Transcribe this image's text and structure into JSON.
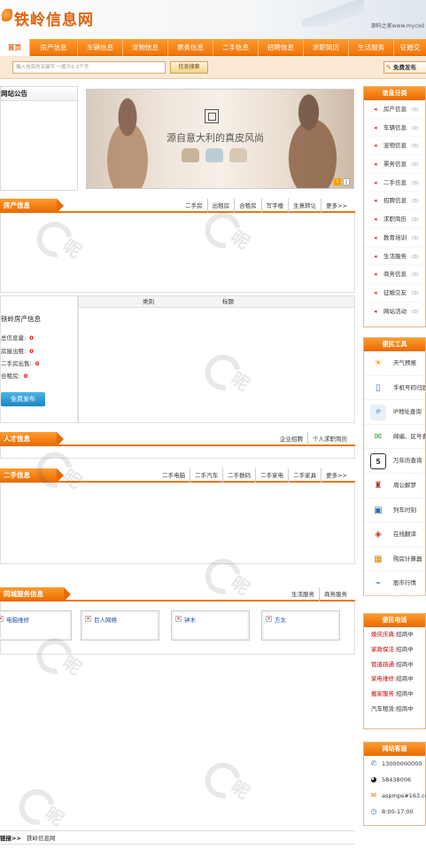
{
  "header": {
    "site_name": "铁岭信息网",
    "right_text": "源码之家www.mycod"
  },
  "nav": {
    "items": [
      "首页",
      "房产信息",
      "车辆信息",
      "宠物信息",
      "票务信息",
      "二手信息",
      "招聘信息",
      "求职简历",
      "生活服务",
      "征婚交"
    ]
  },
  "search": {
    "placeholder": "输入信息的关键字 一般为2-3个字",
    "button": "信息搜索",
    "publish": "免费发布"
  },
  "announce": {
    "title": "网站公告"
  },
  "banner": {
    "tagline": "源自意大利的真皮风尚",
    "pager": [
      "1",
      "2"
    ]
  },
  "sections": {
    "house": {
      "title": "房产信息",
      "links": [
        "二手房",
        "出租房",
        "合租房",
        "写字楼",
        "生意转让",
        "更多>>"
      ]
    },
    "talent": {
      "title": "人才信息",
      "links": [
        "企业招聘",
        "个人求职简历"
      ]
    },
    "second": {
      "title": "二手信息",
      "links": [
        "二手电脑",
        "二手汽车",
        "二手数码",
        "二手家电",
        "二手家具",
        "更多>>"
      ]
    },
    "city": {
      "title": "同城服务信息",
      "links": [
        "生活服务",
        "商务服务"
      ]
    }
  },
  "house_stats": {
    "title": "铁岭房产信息",
    "rows": [
      {
        "label": "总信息量:",
        "value": "0"
      },
      {
        "label": "房屋出租:",
        "value": "0"
      },
      {
        "label": "二手房出售:",
        "value": "0"
      },
      {
        "label": "合租房:",
        "value": "0"
      }
    ],
    "button": "免费发布"
  },
  "house_table": {
    "headers": [
      "类别",
      "标题"
    ]
  },
  "city_services": [
    "电脑维修",
    "巨人网络",
    "钟木",
    "方太"
  ],
  "sidebar": {
    "categories": {
      "title": "信息分类",
      "items": [
        {
          "label": "房产信息",
          "count": "(0)"
        },
        {
          "label": "车辆信息",
          "count": "(0)"
        },
        {
          "label": "宠物信息",
          "count": "(0)"
        },
        {
          "label": "票务信息",
          "count": "(0)"
        },
        {
          "label": "二手信息",
          "count": "(0)"
        },
        {
          "label": "招聘信息",
          "count": "(0)"
        },
        {
          "label": "求职简历",
          "count": "(0)"
        },
        {
          "label": "教育培训",
          "count": "(0)"
        },
        {
          "label": "生活服务",
          "count": "(0)"
        },
        {
          "label": "商务信息",
          "count": "(0)"
        },
        {
          "label": "征婚交友",
          "count": "(0)"
        },
        {
          "label": "网站活动",
          "count": "(0)"
        }
      ]
    },
    "tools": {
      "title": "便民工具",
      "items": [
        {
          "label": "天气预报",
          "icon": "sun-icon"
        },
        {
          "label": "手机号码归属",
          "icon": "phone-icon"
        },
        {
          "label": "IP地址查询",
          "icon": "ip-icon"
        },
        {
          "label": "邮编、区号查",
          "icon": "mail-icon"
        },
        {
          "label": "万年历查询",
          "icon": "calendar-icon"
        },
        {
          "label": "周公解梦",
          "icon": "person-icon"
        },
        {
          "label": "列车时刻",
          "icon": "train-icon"
        },
        {
          "label": "在线翻译",
          "icon": "translate-icon"
        },
        {
          "label": "购房计算器",
          "icon": "calculator-icon"
        },
        {
          "label": "股市行情",
          "icon": "chart-icon"
        }
      ]
    },
    "phones": {
      "title": "便民电话",
      "items": [
        {
          "label": "婚庆庆典:",
          "value": "招商中"
        },
        {
          "label": "家政保洁:",
          "value": "招商中"
        },
        {
          "label": "管道疏通:",
          "value": "招商中"
        },
        {
          "label": "家电维修:",
          "value": "招商中"
        },
        {
          "label": "搬家服务:",
          "value": "招商中"
        },
        {
          "label": "汽车租赁:",
          "value": "招商中"
        }
      ]
    },
    "service": {
      "title": "网站客服",
      "items": [
        {
          "label": "13000000000",
          "icon": "phone-icon"
        },
        {
          "label": "58438006",
          "icon": "qq-icon"
        },
        {
          "label": "aspmps#163.co",
          "icon": "mail-icon"
        },
        {
          "label": "8:00-17:00",
          "icon": "clock-icon"
        }
      ]
    }
  },
  "footer": {
    "label": "链接>>",
    "link": "铁岭信息网"
  }
}
